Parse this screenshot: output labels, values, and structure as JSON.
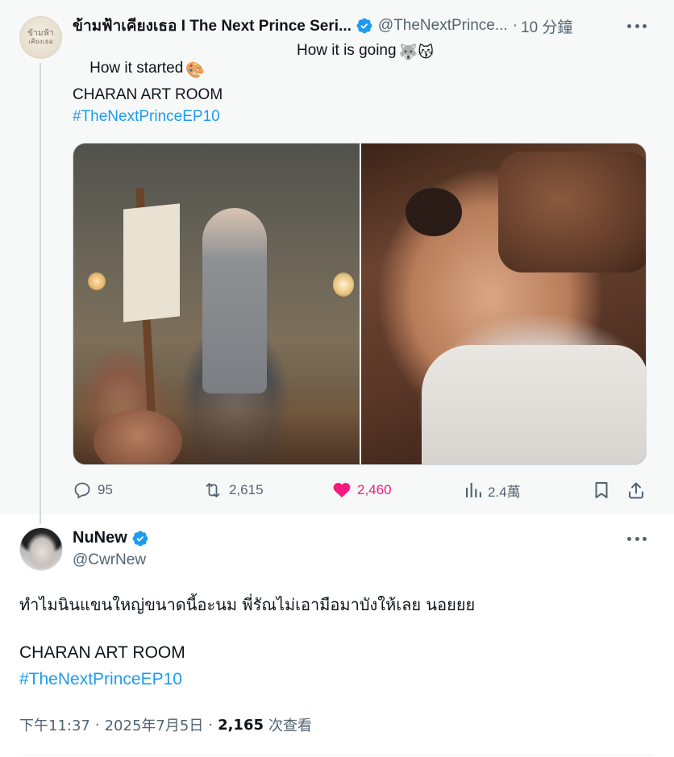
{
  "colors": {
    "accent": "#1d9bf0",
    "like": "#f91880",
    "muted": "#536471",
    "text": "#0f1419"
  },
  "parent_tweet": {
    "avatar": {
      "logo_line1": "ข้ามฟ้า",
      "logo_line2": "เคียงเธอ"
    },
    "display_name": "ข้ามฟ้าเคียงเธอ I The Next Prince Seri...",
    "verified": true,
    "handle": "@TheNextPrince...",
    "separator": "·",
    "time": "10 分鐘",
    "caption_left": "How it started",
    "caption_left_emoji": "🎨",
    "caption_right": "How it is going",
    "caption_right_emoji": "🐺😽",
    "title": "CHARAN ART ROOM",
    "hashtag": "#TheNextPrinceEP10",
    "media": {
      "count": 2,
      "left": "painting-scene-image",
      "right": "sofa-scene-image"
    },
    "actions": {
      "replies": "95",
      "reposts": "2,615",
      "likes": "2,460",
      "liked": true,
      "views": "2.4萬"
    }
  },
  "main_tweet": {
    "display_name": "NuNew",
    "verified": true,
    "handle": "@CwrNew",
    "text": "ทำไมนินแขนใหญ่ขนาดนี้อะนม พี่รัณไม่เอามือมาบังให้เลย นอยยย",
    "title": "CHARAN ART ROOM",
    "hashtag": "#TheNextPrinceEP10",
    "time": "下午11:37",
    "separator": "·",
    "date": "2025年7月5日",
    "views_count": "2,165",
    "views_label": "次查看"
  }
}
